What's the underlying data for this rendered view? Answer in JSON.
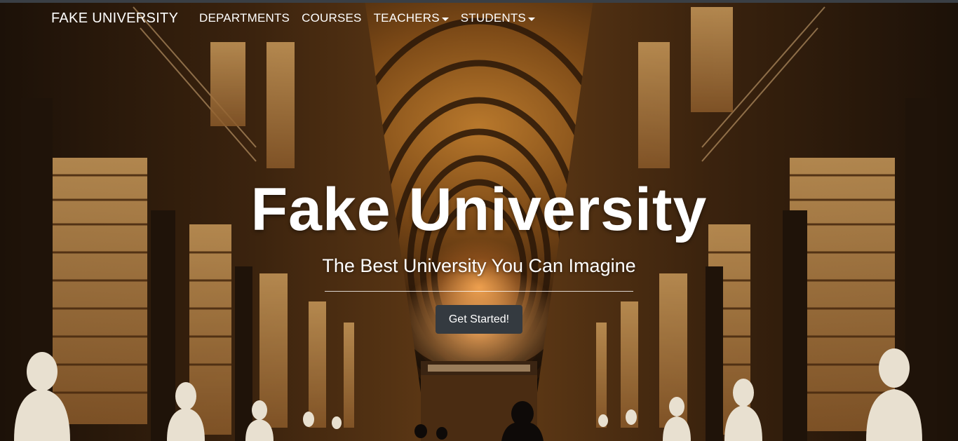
{
  "navbar": {
    "brand": "FAKE UNIVERSITY",
    "links": [
      {
        "label": "DEPARTMENTS",
        "dropdown": false
      },
      {
        "label": "COURSES",
        "dropdown": false
      },
      {
        "label": "TEACHERS",
        "dropdown": true
      },
      {
        "label": "STUDENTS",
        "dropdown": true
      }
    ]
  },
  "masthead": {
    "title": "Fake University",
    "subtitle": "The Best University You Can Imagine",
    "cta_label": "Get Started!",
    "background": "library-hall-photo"
  },
  "colors": {
    "cta_bg": "#343a40",
    "text": "#ffffff",
    "topline": "#3a3f45"
  }
}
